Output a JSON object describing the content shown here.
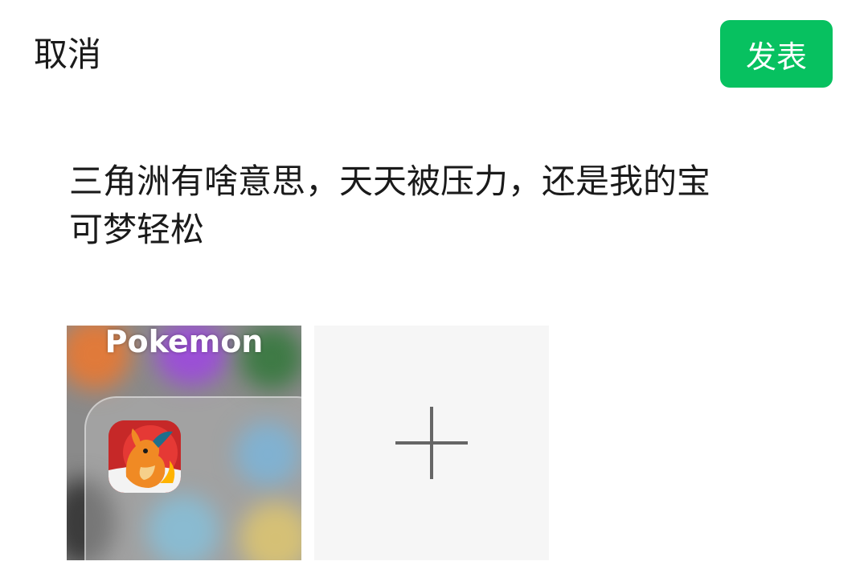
{
  "header": {
    "cancel_label": "取消",
    "publish_label": "发表"
  },
  "post": {
    "text": "三角洲有啥意思，天天被压力，还是我的宝\n可梦轻松"
  },
  "media": {
    "thumbnail_label": "Pokemon",
    "add_icon": "plus-icon"
  },
  "colors": {
    "accent": "#07c160",
    "add_tile_bg": "#f6f6f6",
    "plus": "#666666"
  }
}
